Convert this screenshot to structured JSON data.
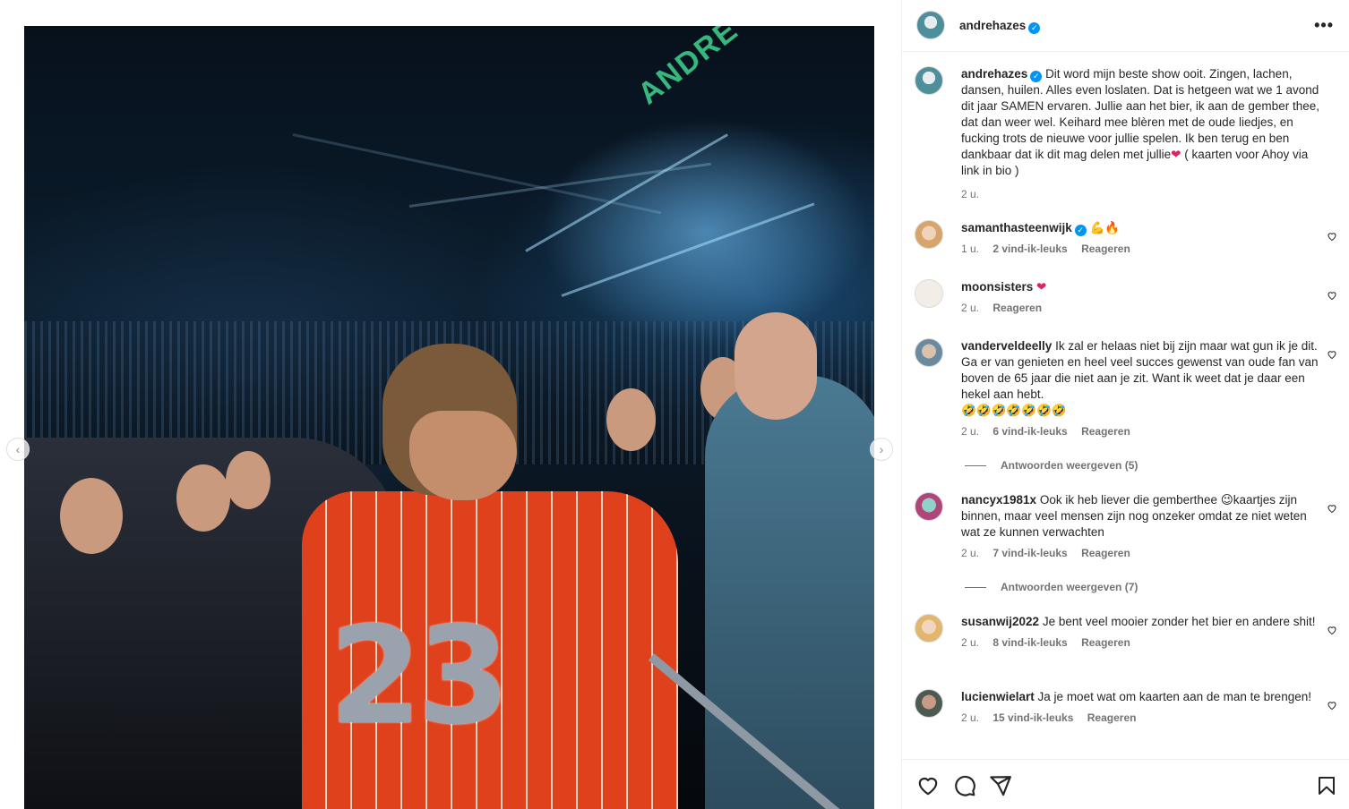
{
  "post": {
    "author": "andrehazes",
    "verified": true
  },
  "photo": {
    "stage_text": "ANDRÉ",
    "jersey_number": "23"
  },
  "caption": {
    "username": "andrehazes",
    "text": "Dit word mijn beste show ooit. Zingen, lachen, dansen, huilen. Alles even loslaten. Dat is hetgeen wat we 1 avond dit jaar SAMEN ervaren. Jullie aan het bier, ik aan de gember thee, dat dan weer wel. Keihard mee blèren met de oude liedjes, en fucking trots de nieuwe voor jullie spelen. Ik ben terug en ben dankbaar dat ik dit mag delen met jullie",
    "emoji": "❤",
    "text_after": " ( kaarten voor Ahoy via link in bio )",
    "time": "2 u."
  },
  "comments": [
    {
      "username": "samanthasteenwijk",
      "verified": true,
      "text": "💪🔥",
      "time": "1 u.",
      "likes": "2 vind-ik-leuks",
      "reply": "Reageren"
    },
    {
      "username": "moonsisters",
      "verified": false,
      "text": "❤",
      "time": "2 u.",
      "likes": "",
      "reply": "Reageren"
    },
    {
      "username": "vanderveldeelly",
      "verified": false,
      "text": "Ik zal er helaas niet bij zijn maar wat gun ik je dit. Ga er van genieten en heel veel succes gewenst van oude fan van boven de 65 jaar die niet aan je zit. Want ik weet dat je daar een hekel aan hebt.",
      "emoji_line": "🤣🤣🤣🤣🤣🤣🤣",
      "time": "2 u.",
      "likes": "6 vind-ik-leuks",
      "reply": "Reageren",
      "view_replies": "Antwoorden weergeven (5)"
    },
    {
      "username": "nancyx1981x",
      "verified": false,
      "text": "Ook ik heb liever die gemberthee 😉kaartjes zijn binnen, maar veel mensen zijn nog onzeker omdat ze niet weten wat ze kunnen verwachten",
      "time": "2 u.",
      "likes": "7 vind-ik-leuks",
      "reply": "Reageren",
      "view_replies": "Antwoorden weergeven (7)"
    },
    {
      "username": "susanwij2022",
      "verified": false,
      "text": "Je bent veel mooier zonder het bier en andere shit!",
      "time": "2 u.",
      "likes": "8 vind-ik-leuks",
      "reply": "Reageren"
    },
    {
      "username": "lucienwielart",
      "verified": false,
      "text": "Ja je moet wat om kaarten aan de man te brengen!",
      "time": "2 u.",
      "likes": "15 vind-ik-leuks",
      "reply": "Reageren"
    }
  ],
  "icons": {
    "more": "more-options-icon",
    "like": "heart-icon",
    "comment": "comment-icon",
    "share": "share-icon",
    "save": "bookmark-icon",
    "prev": "chevron-left-icon",
    "next": "chevron-right-icon"
  },
  "colors": {
    "verified": "#0095f6",
    "muted_text": "#737373",
    "heart_red": "#e0245e"
  }
}
